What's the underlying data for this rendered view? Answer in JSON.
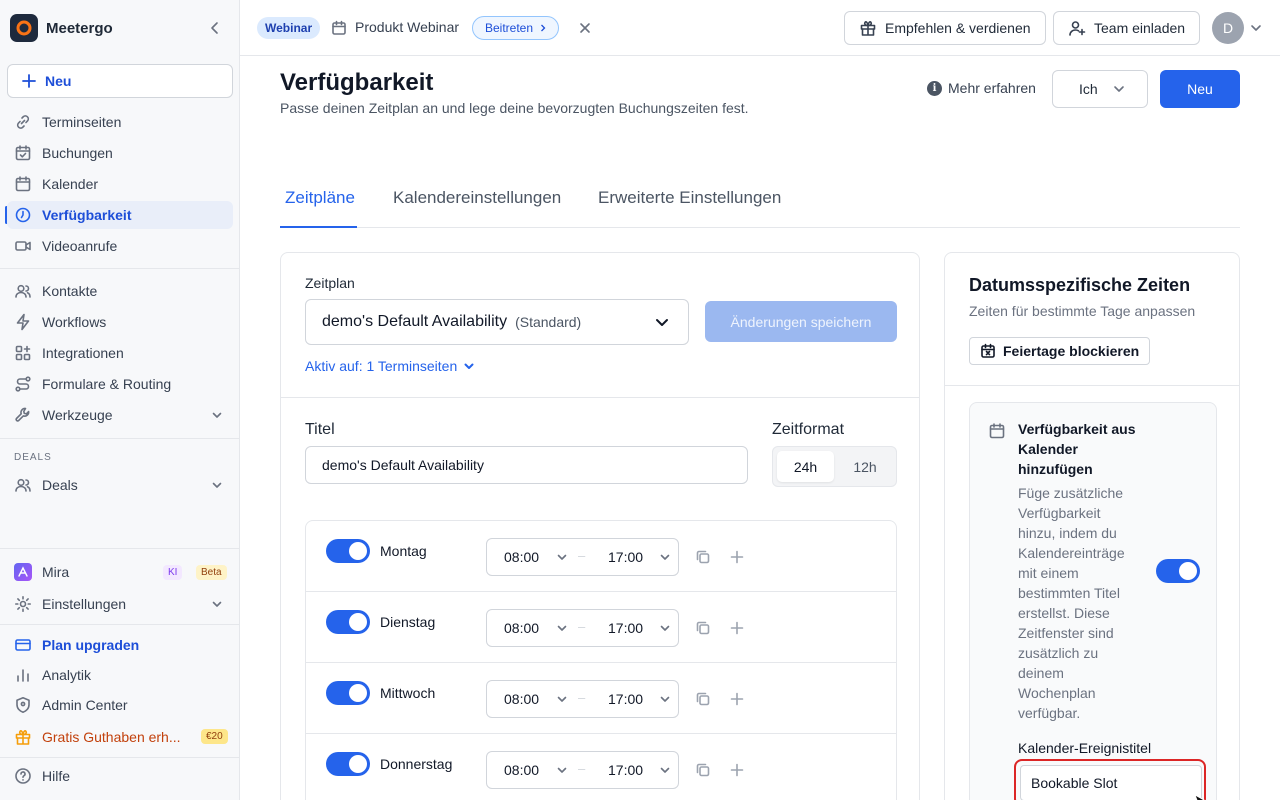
{
  "app": {
    "name": "Meetergo"
  },
  "sidebar": {
    "new_label": "Neu",
    "items": [
      {
        "label": "Terminseiten"
      },
      {
        "label": "Buchungen"
      },
      {
        "label": "Kalender"
      },
      {
        "label": "Verfügbarkeit"
      },
      {
        "label": "Videoanrufe"
      },
      {
        "label": "Kontakte"
      },
      {
        "label": "Workflows"
      },
      {
        "label": "Integrationen"
      },
      {
        "label": "Formulare & Routing"
      },
      {
        "label": "Werkzeuge"
      }
    ],
    "deals_section": "DEALS",
    "deals_label": "Deals",
    "mira": {
      "label": "Mira",
      "badge_ki": "KI",
      "badge_beta": "Beta"
    },
    "settings_label": "Einstellungen",
    "upgrade_label": "Plan upgraden",
    "analytics_label": "Analytik",
    "admin_label": "Admin Center",
    "credit": {
      "label": "Gratis Guthaben erh...",
      "badge": "€20"
    },
    "help_label": "Hilfe"
  },
  "topbar": {
    "event_type": "Webinar",
    "event_title": "Produkt Webinar",
    "join_label": "Beitreten",
    "refer_label": "Empfehlen & verdienen",
    "invite_label": "Team einladen",
    "avatar_initial": "D"
  },
  "page": {
    "title": "Verfügbarkeit",
    "subtitle": "Passe deinen Zeitplan an und lege deine bevorzugten Buchungszeiten fest.",
    "learn_more": "Mehr erfahren",
    "owner_select": "Ich",
    "new_button": "Neu",
    "tabs": [
      "Zeitpläne",
      "Kalendereinstellungen",
      "Erweiterte Einstellungen"
    ]
  },
  "schedule": {
    "section_label": "Zeitplan",
    "selected_name": "demo's Default Availability",
    "selected_tag": "(Standard)",
    "save_label": "Änderungen speichern",
    "active_on": "Aktiv auf: 1 Terminseiten",
    "title_label": "Titel",
    "title_value": "demo's Default Availability",
    "format_label": "Zeitformat",
    "format_24": "24h",
    "format_12": "12h",
    "days": [
      {
        "name": "Montag",
        "from": "08:00",
        "to": "17:00",
        "enabled": true
      },
      {
        "name": "Dienstag",
        "from": "08:00",
        "to": "17:00",
        "enabled": true
      },
      {
        "name": "Mittwoch",
        "from": "08:00",
        "to": "17:00",
        "enabled": true
      },
      {
        "name": "Donnerstag",
        "from": "08:00",
        "to": "17:00",
        "enabled": true
      }
    ],
    "dash": "–"
  },
  "date_specific": {
    "title": "Datumsspezifische Zeiten",
    "subtitle": "Zeiten für bestimmte Tage anpassen",
    "block_holidays": "Feiertage blockieren",
    "calendar_block": {
      "title": "Verfügbarkeit aus Kalender hinzufügen",
      "description": "Füge zusätzliche Verfügbarkeit hinzu, indem du Kalendereinträge mit einem bestimmten Titel erstellst. Diese Zeitfenster sind zusätzlich zu deinem Wochenplan verfügbar.",
      "enabled": true,
      "event_title_label": "Kalender-Ereignistitel",
      "event_title_value": "Bookable Slot"
    }
  },
  "colors": {
    "accent": "#2563eb",
    "highlight": "#dc2626",
    "sidebar_bg": "#f7f8fa"
  }
}
